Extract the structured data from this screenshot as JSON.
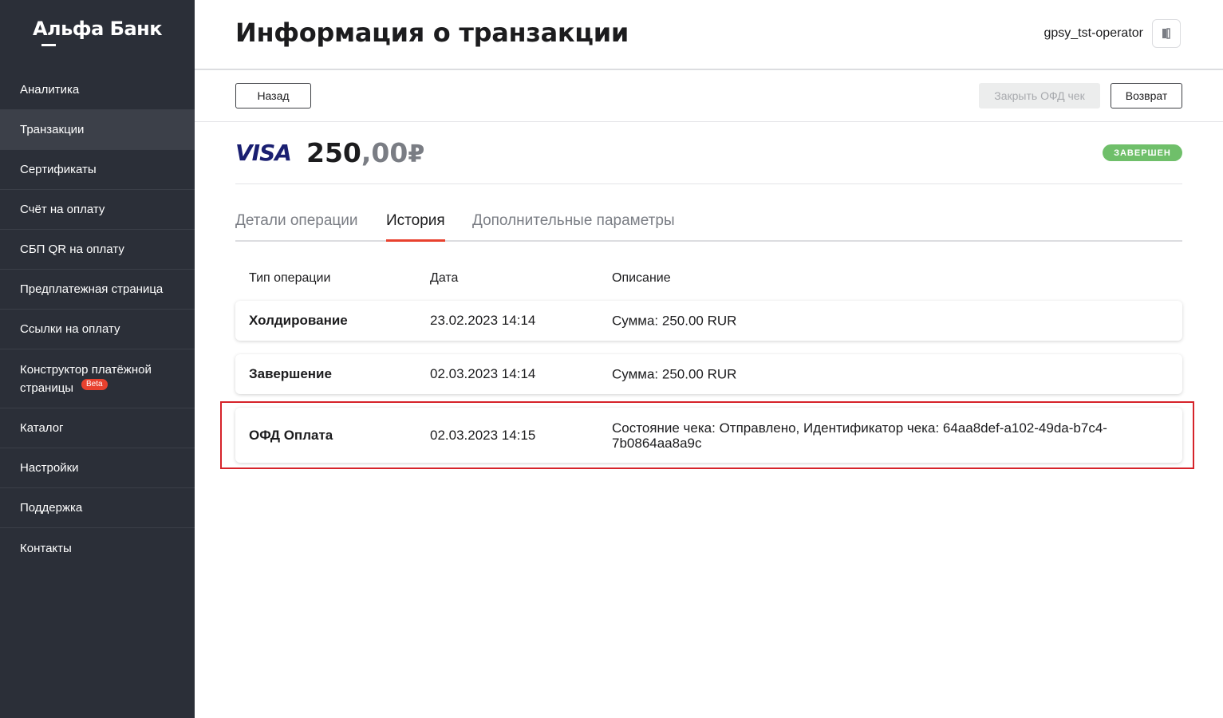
{
  "brand": {
    "logo_text": "Альфа Банк"
  },
  "sidebar": {
    "items": [
      {
        "label": "Аналитика"
      },
      {
        "label": "Транзакции"
      },
      {
        "label": "Сертификаты"
      },
      {
        "label": "Счёт на оплату"
      },
      {
        "label": "СБП QR на оплату"
      },
      {
        "label": "Предплатежная страница"
      },
      {
        "label": "Ссылки на оплату"
      },
      {
        "label": "Конструктор платёжной страницы",
        "badge": "Beta"
      },
      {
        "label": "Каталог"
      },
      {
        "label": "Настройки"
      },
      {
        "label": "Поддержка"
      },
      {
        "label": "Контакты"
      }
    ],
    "active_item": "Транзакции"
  },
  "header": {
    "title": "Информация о транзакции",
    "username": "gpsy_tst-operator",
    "logout_icon": "logout-icon"
  },
  "toolbar": {
    "back_label": "Назад",
    "close_ofd_label": "Закрыть ОФД чек",
    "refund_label": "Возврат"
  },
  "transaction": {
    "card_brand": "VISA",
    "amount_int": "250",
    "amount_dec": ",00",
    "currency": "₽",
    "status": "ЗАВЕРШЕН",
    "status_color": "#6fbf6a"
  },
  "tabs": [
    {
      "label": "Детали операции",
      "active": false
    },
    {
      "label": "История",
      "active": true
    },
    {
      "label": "Дополнительные параметры",
      "active": false
    }
  ],
  "history": {
    "columns": [
      "Тип операции",
      "Дата",
      "Описание"
    ],
    "rows": [
      {
        "type": "Холдирование",
        "date": "23.02.2023 14:14",
        "description": "Сумма: 250.00 RUR"
      },
      {
        "type": "Завершение",
        "date": "02.03.2023 14:14",
        "description": "Сумма: 250.00 RUR"
      },
      {
        "type": "ОФД Оплата",
        "date": "02.03.2023 14:15",
        "description": "Состояние чека: Отправлено, Идентификатор чека: 64aa8def-a102-49da-b7c4-7b0864aa8a9c"
      }
    ]
  },
  "colors": {
    "accent": "#e8412e",
    "sidebar_bg": "#2b2f38",
    "highlight_border": "#d6232a"
  }
}
